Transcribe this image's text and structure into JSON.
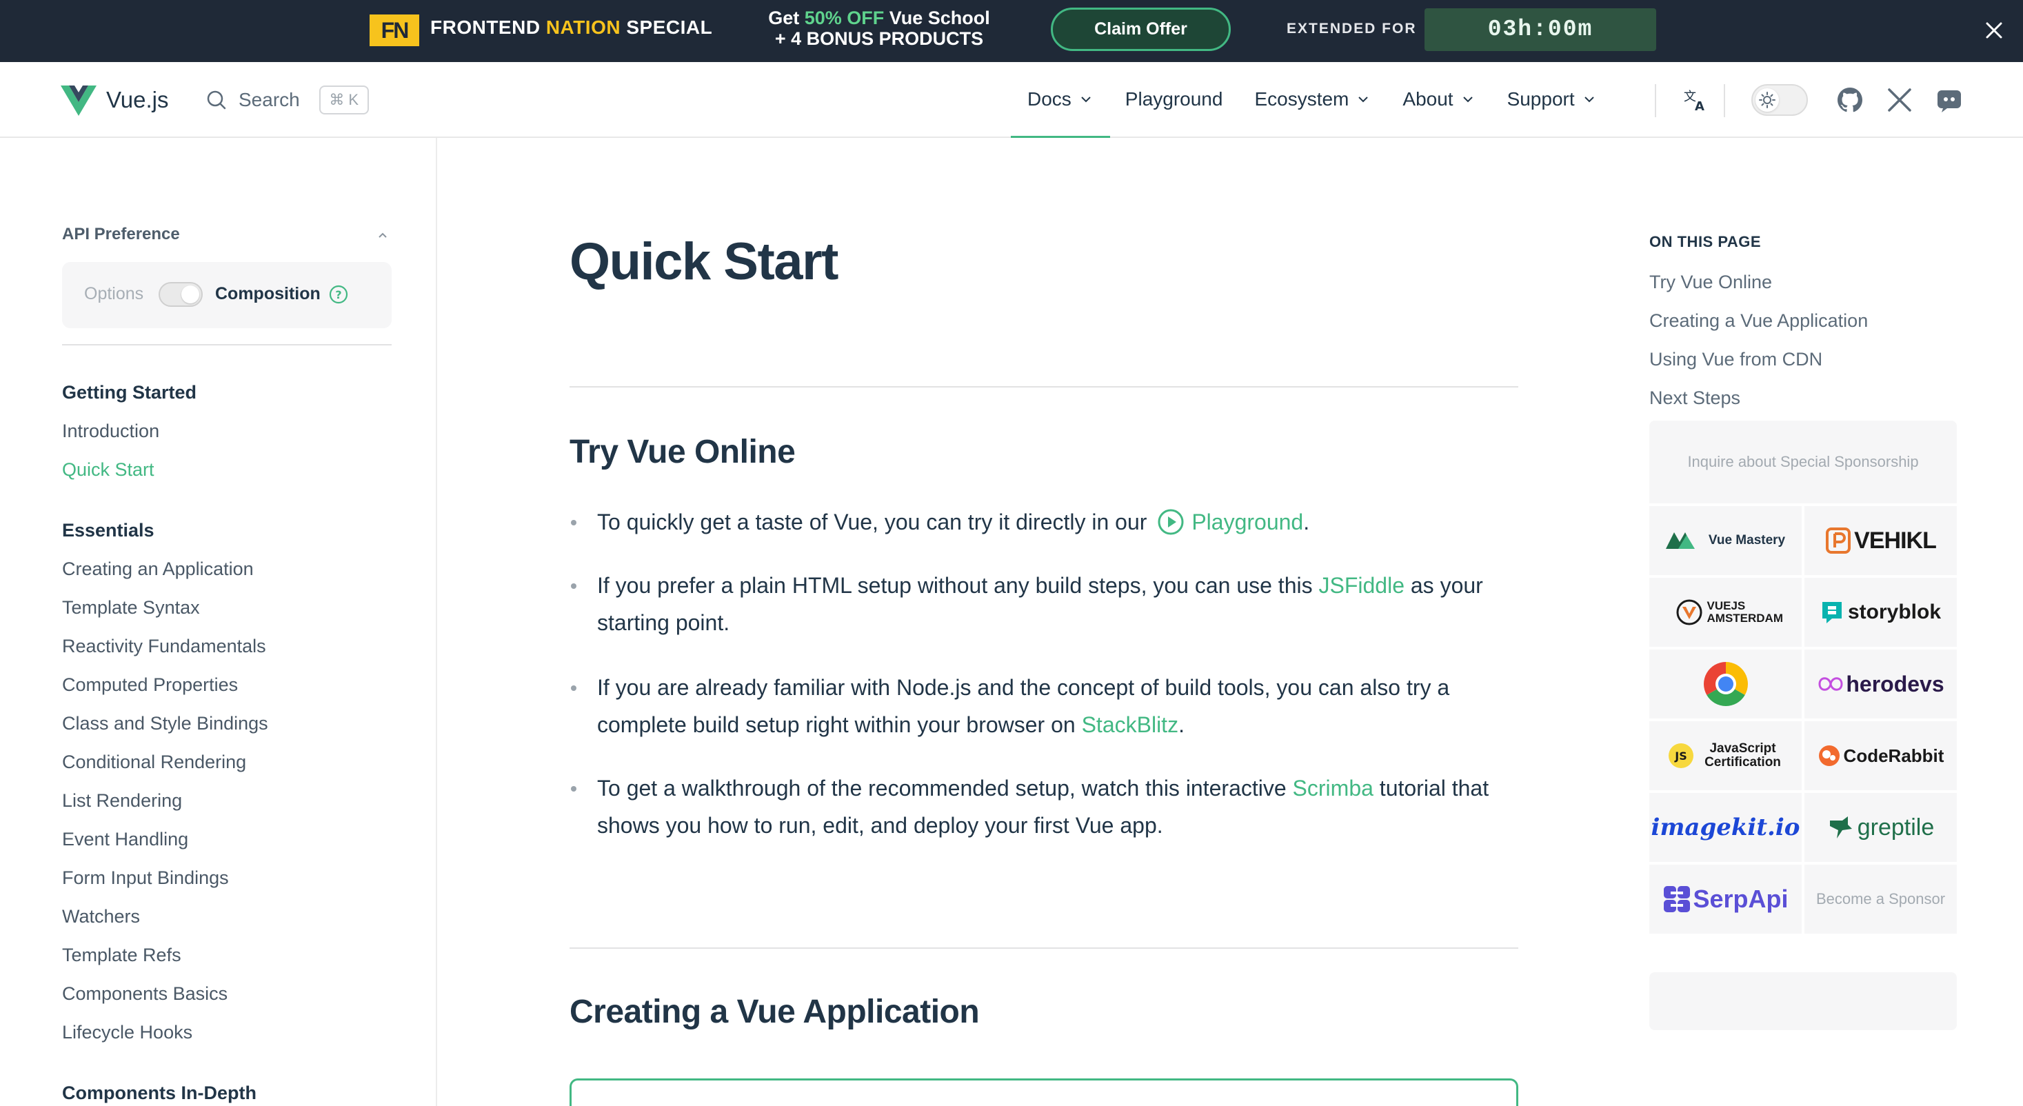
{
  "banner": {
    "logo_text": "FN",
    "brand_part1": "FRONTEND ",
    "brand_part2": "NATION",
    "brand_part3": " SPECIAL",
    "promo_line1_pre": "Get ",
    "promo_line1_highlight": "50% OFF",
    "promo_line1_post": " Vue School",
    "promo_line2": "+ 4 BONUS PRODUCTS",
    "cta_label": "Claim Offer",
    "extended_label": "EXTENDED FOR",
    "timer": "03h:00m",
    "colors": {
      "background": "#1f2937",
      "accent_yellow": "#f7c31d",
      "accent_green": "#42b883"
    }
  },
  "nav": {
    "title": "Vue.js",
    "search_label": "Search",
    "search_shortcut": "⌘ K",
    "menu": [
      {
        "label": "Docs",
        "dropdown": true,
        "active": true
      },
      {
        "label": "Playground",
        "dropdown": false,
        "active": false
      },
      {
        "label": "Ecosystem",
        "dropdown": true,
        "active": false
      },
      {
        "label": "About",
        "dropdown": true,
        "active": false
      },
      {
        "label": "Support",
        "dropdown": true,
        "active": false
      }
    ],
    "icons": [
      "translate-icon",
      "sun-icon",
      "github-icon",
      "x-icon",
      "discord-icon"
    ]
  },
  "sidebar": {
    "api_pref_title": "API Preference",
    "api_options_label": "Options",
    "api_composition_label": "Composition",
    "groups": [
      {
        "title": "Getting Started",
        "items": [
          "Introduction",
          "Quick Start"
        ]
      },
      {
        "title": "Essentials",
        "items": [
          "Creating an Application",
          "Template Syntax",
          "Reactivity Fundamentals",
          "Computed Properties",
          "Class and Style Bindings",
          "Conditional Rendering",
          "List Rendering",
          "Event Handling",
          "Form Input Bindings",
          "Watchers",
          "Template Refs",
          "Components Basics",
          "Lifecycle Hooks"
        ]
      },
      {
        "title": "Components In-Depth",
        "items": []
      }
    ],
    "active_item": "Quick Start"
  },
  "main": {
    "title": "Quick Start",
    "section1_title": "Try Vue Online",
    "bullets": [
      {
        "pre": "To quickly get a taste of Vue, you can try it directly in our ",
        "link": "Playground",
        "post": "."
      },
      {
        "pre": "If you prefer a plain HTML setup without any build steps, you can use this ",
        "link": "JSFiddle",
        "post": " as your starting point."
      },
      {
        "pre": "If you are already familiar with Node.js and the concept of build tools, you can also try a complete build setup right within your browser on ",
        "link": "StackBlitz",
        "post": "."
      },
      {
        "pre": "To get a walkthrough of the recommended setup, watch this interactive ",
        "link": "Scrimba",
        "post": " tutorial that shows you how to run, edit, and deploy your first Vue app."
      }
    ],
    "section2_title": "Creating a Vue Application"
  },
  "aside": {
    "on_this_page": "ON THIS PAGE",
    "links": [
      "Try Vue Online",
      "Creating a Vue Application",
      "Using Vue from CDN",
      "Next Steps"
    ],
    "special_sponsor": "Inquire about Special Sponsorship",
    "sponsors": [
      "Vue Mastery",
      "VEHIKL",
      "VUEJS AMSTERDAM",
      "storyblok",
      "chrome-logo",
      "herodevs",
      "JavaScript Certification",
      "CodeRabbit",
      "imagekit.io",
      "greptile",
      "SerpApi",
      "Become a Sponsor"
    ]
  },
  "colors": {
    "brand_green": "#42b883",
    "text": "#213547",
    "muted": "#5c6b79"
  }
}
